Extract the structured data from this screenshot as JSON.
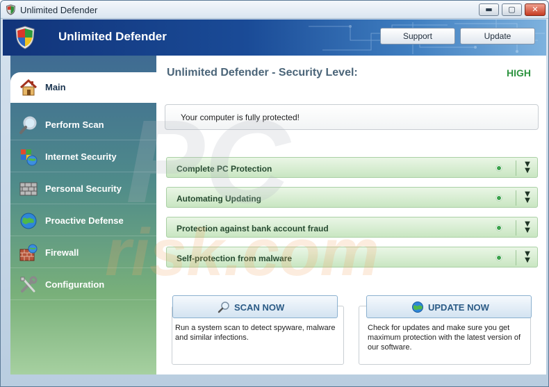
{
  "window": {
    "title": "Unlimited Defender",
    "controls": {
      "minimize": "▬",
      "maximize": "▢",
      "close": "✕"
    }
  },
  "header": {
    "app_title": "Unlimited Defender",
    "support_label": "Support",
    "update_label": "Update"
  },
  "sidebar": {
    "items": [
      {
        "label": "Main",
        "icon": "house-icon",
        "active": true
      },
      {
        "label": "Perform Scan",
        "icon": "magnifier-icon",
        "active": false
      },
      {
        "label": "Internet Security",
        "icon": "globe-windows-icon",
        "active": false
      },
      {
        "label": "Personal Security",
        "icon": "brick-wall-icon",
        "active": false
      },
      {
        "label": "Proactive Defense",
        "icon": "globe-icon",
        "active": false
      },
      {
        "label": "Firewall",
        "icon": "firewall-icon",
        "active": false
      },
      {
        "label": "Configuration",
        "icon": "tools-icon",
        "active": false
      }
    ]
  },
  "main": {
    "heading": "Unlimited Defender - Security Level:",
    "level": "HIGH",
    "status": "Your computer is fully protected!",
    "features": [
      {
        "label": "Complete PC Protection"
      },
      {
        "label": "Automating Updating"
      },
      {
        "label": "Protection against bank account fraud"
      },
      {
        "label": "Self-protection from malware"
      }
    ],
    "expand_glyph": "▼\n▼",
    "scan": {
      "button_label": "SCAN NOW",
      "description": "Run a system scan to detect spyware, malware and similar infections."
    },
    "update": {
      "button_label": "UPDATE NOW",
      "description": "Check for updates and make sure you get maximum protection with the latest version of our software."
    }
  },
  "watermark": {
    "line1": "PC",
    "line2": "risk.com"
  },
  "colors": {
    "header_dark": "#11347a",
    "level_green": "#2e9440",
    "feature_green": "#c9e6c2",
    "button_blue_text": "#2b5b86"
  }
}
